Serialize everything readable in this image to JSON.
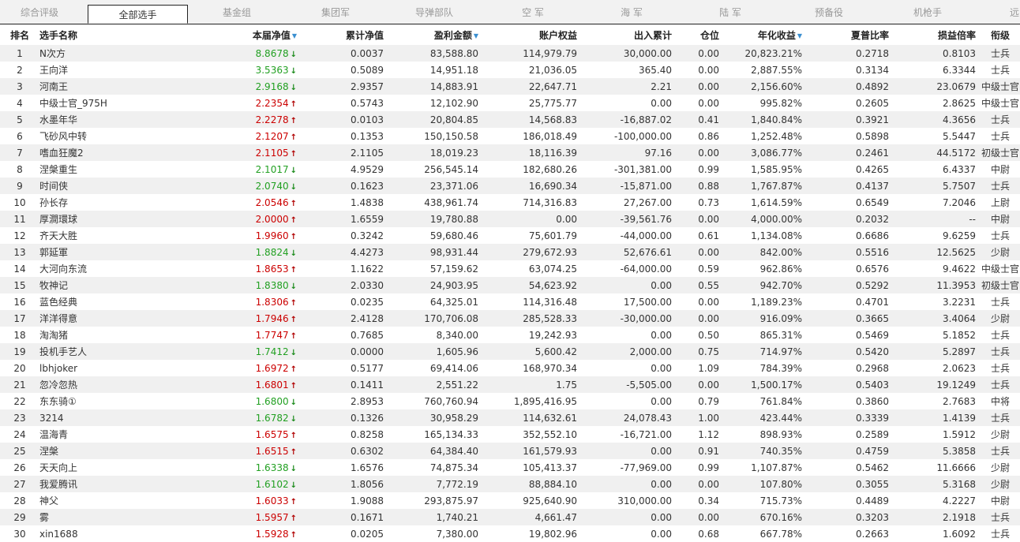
{
  "tabs": [
    "综合评级",
    "全部选手",
    "基金组",
    "集团军",
    "导弹部队",
    "空  军",
    "海  军",
    "陆  军",
    "预备役",
    "机枪手",
    "远"
  ],
  "active_tab": "全部选手",
  "headers": {
    "rank": "排名",
    "name": "选手名称",
    "nav": "本届净值",
    "cum_nav": "累计净值",
    "profit": "盈利金额",
    "equity": "账户权益",
    "inout": "出入累计",
    "position": "仓位",
    "annual": "年化收益",
    "sharpe": "夏普比率",
    "pl_ratio": "损益倍率",
    "title": "衔级"
  },
  "colors": {
    "up": "#cc0000",
    "down": "#22a022",
    "sort_icon": "#3a8fd0"
  },
  "rows": [
    {
      "rank": "1",
      "name": "N次方",
      "nav": "8.8678",
      "dir": "down",
      "cum": "0.0037",
      "profit": "83,588.80",
      "equity": "114,979.79",
      "inout": "30,000.00",
      "pos": "0.00",
      "annual": "20,823.21%",
      "sharpe": "0.2718",
      "pl": "0.8103",
      "title": "士兵"
    },
    {
      "rank": "2",
      "name": "王向洋",
      "nav": "3.5363",
      "dir": "down",
      "cum": "0.5089",
      "profit": "14,951.18",
      "equity": "21,036.05",
      "inout": "365.40",
      "pos": "0.00",
      "annual": "2,887.55%",
      "sharpe": "0.3134",
      "pl": "6.3344",
      "title": "士兵"
    },
    {
      "rank": "3",
      "name": "河南王",
      "nav": "2.9168",
      "dir": "down",
      "cum": "2.9357",
      "profit": "14,883.91",
      "equity": "22,647.71",
      "inout": "2.21",
      "pos": "0.00",
      "annual": "2,156.60%",
      "sharpe": "0.4892",
      "pl": "23.0679",
      "title": "中级士官"
    },
    {
      "rank": "4",
      "name": "中级士官_975H",
      "nav": "2.2354",
      "dir": "up",
      "cum": "0.5743",
      "profit": "12,102.90",
      "equity": "25,775.77",
      "inout": "0.00",
      "pos": "0.00",
      "annual": "995.82%",
      "sharpe": "0.2605",
      "pl": "2.8625",
      "title": "中级士官"
    },
    {
      "rank": "5",
      "name": "水墨年华",
      "nav": "2.2278",
      "dir": "up",
      "cum": "0.0103",
      "profit": "20,804.85",
      "equity": "14,568.83",
      "inout": "-16,887.02",
      "pos": "0.41",
      "annual": "1,840.84%",
      "sharpe": "0.3921",
      "pl": "4.3656",
      "title": "士兵"
    },
    {
      "rank": "6",
      "name": "飞砂风中转",
      "nav": "2.1207",
      "dir": "up",
      "cum": "0.1353",
      "profit": "150,150.58",
      "equity": "186,018.49",
      "inout": "-100,000.00",
      "pos": "0.86",
      "annual": "1,252.48%",
      "sharpe": "0.5898",
      "pl": "5.5447",
      "title": "士兵"
    },
    {
      "rank": "7",
      "name": "嗜血狂魔2",
      "nav": "2.1105",
      "dir": "up",
      "cum": "2.1105",
      "profit": "18,019.23",
      "equity": "18,116.39",
      "inout": "97.16",
      "pos": "0.00",
      "annual": "3,086.77%",
      "sharpe": "0.2461",
      "pl": "44.5172",
      "title": "初级士官"
    },
    {
      "rank": "8",
      "name": "涅槃重生",
      "nav": "2.1017",
      "dir": "down",
      "cum": "4.9529",
      "profit": "256,545.14",
      "equity": "182,680.26",
      "inout": "-301,381.00",
      "pos": "0.99",
      "annual": "1,585.95%",
      "sharpe": "0.4265",
      "pl": "6.4337",
      "title": "中尉"
    },
    {
      "rank": "9",
      "name": "时间侠",
      "nav": "2.0740",
      "dir": "down",
      "cum": "0.1623",
      "profit": "23,371.06",
      "equity": "16,690.34",
      "inout": "-15,871.00",
      "pos": "0.88",
      "annual": "1,767.87%",
      "sharpe": "0.4137",
      "pl": "5.7507",
      "title": "士兵"
    },
    {
      "rank": "10",
      "name": "孙长存",
      "nav": "2.0546",
      "dir": "up",
      "cum": "1.4838",
      "profit": "438,961.74",
      "equity": "714,316.83",
      "inout": "27,267.00",
      "pos": "0.73",
      "annual": "1,614.59%",
      "sharpe": "0.6549",
      "pl": "7.2046",
      "title": "上尉"
    },
    {
      "rank": "11",
      "name": "厚澗環球",
      "nav": "2.0000",
      "dir": "up",
      "cum": "1.6559",
      "profit": "19,780.88",
      "equity": "0.00",
      "inout": "-39,561.76",
      "pos": "0.00",
      "annual": "4,000.00%",
      "sharpe": "0.2032",
      "pl": "--",
      "title": "中尉"
    },
    {
      "rank": "12",
      "name": "齐天大胜",
      "nav": "1.9960",
      "dir": "up",
      "cum": "0.3242",
      "profit": "59,680.46",
      "equity": "75,601.79",
      "inout": "-44,000.00",
      "pos": "0.61",
      "annual": "1,134.08%",
      "sharpe": "0.6686",
      "pl": "9.6259",
      "title": "士兵"
    },
    {
      "rank": "13",
      "name": "郭延軍",
      "nav": "1.8824",
      "dir": "down",
      "cum": "4.4273",
      "profit": "98,931.44",
      "equity": "279,672.93",
      "inout": "52,676.61",
      "pos": "0.00",
      "annual": "842.00%",
      "sharpe": "0.5516",
      "pl": "12.5625",
      "title": "少尉"
    },
    {
      "rank": "14",
      "name": "大河向东流",
      "nav": "1.8653",
      "dir": "up",
      "cum": "1.1622",
      "profit": "57,159.62",
      "equity": "63,074.25",
      "inout": "-64,000.00",
      "pos": "0.59",
      "annual": "962.86%",
      "sharpe": "0.6576",
      "pl": "9.4622",
      "title": "中级士官"
    },
    {
      "rank": "15",
      "name": "牧神记",
      "nav": "1.8380",
      "dir": "down",
      "cum": "2.0330",
      "profit": "24,903.95",
      "equity": "54,623.92",
      "inout": "0.00",
      "pos": "0.55",
      "annual": "942.70%",
      "sharpe": "0.5292",
      "pl": "11.3953",
      "title": "初级士官"
    },
    {
      "rank": "16",
      "name": "蓝色经典",
      "nav": "1.8306",
      "dir": "up",
      "cum": "0.0235",
      "profit": "64,325.01",
      "equity": "114,316.48",
      "inout": "17,500.00",
      "pos": "0.00",
      "annual": "1,189.23%",
      "sharpe": "0.4701",
      "pl": "3.2231",
      "title": "士兵"
    },
    {
      "rank": "17",
      "name": "洋洋得意",
      "nav": "1.7946",
      "dir": "up",
      "cum": "2.4128",
      "profit": "170,706.08",
      "equity": "285,528.33",
      "inout": "-30,000.00",
      "pos": "0.00",
      "annual": "916.09%",
      "sharpe": "0.3665",
      "pl": "3.4064",
      "title": "少尉"
    },
    {
      "rank": "18",
      "name": "淘淘猪",
      "nav": "1.7747",
      "dir": "up",
      "cum": "0.7685",
      "profit": "8,340.00",
      "equity": "19,242.93",
      "inout": "0.00",
      "pos": "0.50",
      "annual": "865.31%",
      "sharpe": "0.5469",
      "pl": "5.1852",
      "title": "士兵"
    },
    {
      "rank": "19",
      "name": "投机手艺人",
      "nav": "1.7412",
      "dir": "down",
      "cum": "0.0000",
      "profit": "1,605.96",
      "equity": "5,600.42",
      "inout": "2,000.00",
      "pos": "0.75",
      "annual": "714.97%",
      "sharpe": "0.5420",
      "pl": "5.2897",
      "title": "士兵"
    },
    {
      "rank": "20",
      "name": "lbhjoker",
      "nav": "1.6972",
      "dir": "up",
      "cum": "0.5177",
      "profit": "69,414.06",
      "equity": "168,970.34",
      "inout": "0.00",
      "pos": "1.09",
      "annual": "784.39%",
      "sharpe": "0.2968",
      "pl": "2.0623",
      "title": "士兵"
    },
    {
      "rank": "21",
      "name": "忽冷忽热",
      "nav": "1.6801",
      "dir": "up",
      "cum": "0.1411",
      "profit": "2,551.22",
      "equity": "1.75",
      "inout": "-5,505.00",
      "pos": "0.00",
      "annual": "1,500.17%",
      "sharpe": "0.5403",
      "pl": "19.1249",
      "title": "士兵"
    },
    {
      "rank": "22",
      "name": "东东骑①",
      "nav": "1.6800",
      "dir": "down",
      "cum": "2.8953",
      "profit": "760,760.94",
      "equity": "1,895,416.95",
      "inout": "0.00",
      "pos": "0.79",
      "annual": "761.84%",
      "sharpe": "0.3860",
      "pl": "2.7683",
      "title": "中将"
    },
    {
      "rank": "23",
      "name": "3214",
      "nav": "1.6782",
      "dir": "down",
      "cum": "0.1326",
      "profit": "30,958.29",
      "equity": "114,632.61",
      "inout": "24,078.43",
      "pos": "1.00",
      "annual": "423.44%",
      "sharpe": "0.3339",
      "pl": "1.4139",
      "title": "士兵"
    },
    {
      "rank": "24",
      "name": "温海青",
      "nav": "1.6575",
      "dir": "up",
      "cum": "0.8258",
      "profit": "165,134.33",
      "equity": "352,552.10",
      "inout": "-16,721.00",
      "pos": "1.12",
      "annual": "898.93%",
      "sharpe": "0.2589",
      "pl": "1.5912",
      "title": "少尉"
    },
    {
      "rank": "25",
      "name": "涅槃",
      "nav": "1.6515",
      "dir": "up",
      "cum": "0.6302",
      "profit": "64,384.40",
      "equity": "161,579.93",
      "inout": "0.00",
      "pos": "0.91",
      "annual": "740.35%",
      "sharpe": "0.4759",
      "pl": "5.3858",
      "title": "士兵"
    },
    {
      "rank": "26",
      "name": "天天向上",
      "nav": "1.6338",
      "dir": "down",
      "cum": "1.6576",
      "profit": "74,875.34",
      "equity": "105,413.37",
      "inout": "-77,969.00",
      "pos": "0.99",
      "annual": "1,107.87%",
      "sharpe": "0.5462",
      "pl": "11.6666",
      "title": "少尉"
    },
    {
      "rank": "27",
      "name": "我爱腾讯",
      "nav": "1.6102",
      "dir": "down",
      "cum": "1.8056",
      "profit": "7,772.19",
      "equity": "88,884.10",
      "inout": "0.00",
      "pos": "0.00",
      "annual": "107.80%",
      "sharpe": "0.3055",
      "pl": "5.3168",
      "title": "少尉"
    },
    {
      "rank": "28",
      "name": "神父",
      "nav": "1.6033",
      "dir": "up",
      "cum": "1.9088",
      "profit": "293,875.97",
      "equity": "925,640.90",
      "inout": "310,000.00",
      "pos": "0.34",
      "annual": "715.73%",
      "sharpe": "0.4489",
      "pl": "4.2227",
      "title": "中尉"
    },
    {
      "rank": "29",
      "name": "雾",
      "nav": "1.5957",
      "dir": "up",
      "cum": "0.1671",
      "profit": "1,740.21",
      "equity": "4,661.47",
      "inout": "0.00",
      "pos": "0.00",
      "annual": "670.16%",
      "sharpe": "0.3203",
      "pl": "2.1918",
      "title": "士兵"
    },
    {
      "rank": "30",
      "name": "xin1688",
      "nav": "1.5928",
      "dir": "up",
      "cum": "0.0205",
      "profit": "7,380.00",
      "equity": "19,802.96",
      "inout": "0.00",
      "pos": "0.68",
      "annual": "667.78%",
      "sharpe": "0.2663",
      "pl": "1.6092",
      "title": "士兵"
    }
  ]
}
